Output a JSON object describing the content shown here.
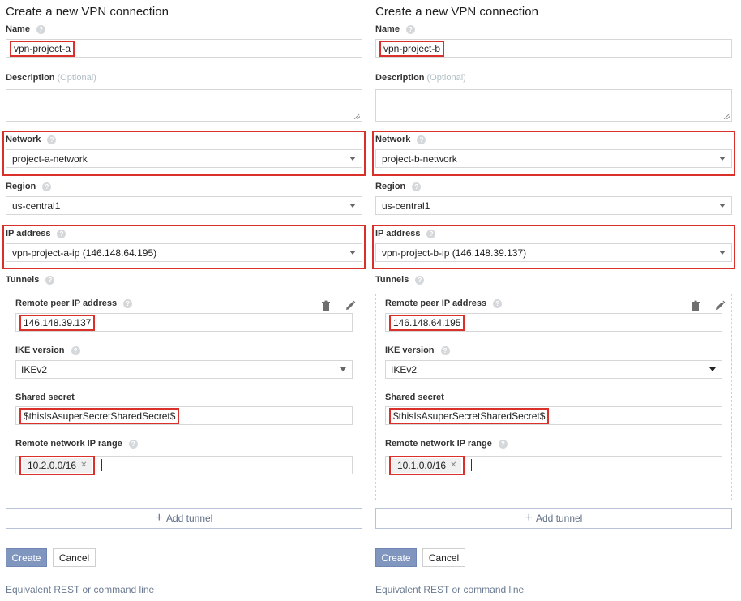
{
  "panels": [
    {
      "title": "Create a new VPN connection",
      "name_label": "Name",
      "name_value": "vpn-project-a",
      "description_label": "Description",
      "description_optional": "(Optional)",
      "network_label": "Network",
      "network_value": "project-a-network",
      "region_label": "Region",
      "region_value": "us-central1",
      "ip_label": "IP address",
      "ip_value": "vpn-project-a-ip (146.148.64.195)",
      "tunnels_label": "Tunnels",
      "peer_label": "Remote peer IP address",
      "peer_value": "146.148.39.137",
      "ike_label": "IKE version",
      "ike_value": "IKEv2",
      "secret_label": "Shared secret",
      "secret_value": "$thisIsAsuperSecretSharedSecret$",
      "range_label": "Remote network IP range",
      "range_value": "10.2.0.0/16",
      "add_tunnel": "Add tunnel",
      "create": "Create",
      "cancel": "Cancel",
      "rest_link": "Equivalent REST or command line"
    },
    {
      "title": "Create a new VPN connection",
      "name_label": "Name",
      "name_value": "vpn-project-b",
      "description_label": "Description",
      "description_optional": "(Optional)",
      "network_label": "Network",
      "network_value": "project-b-network",
      "region_label": "Region",
      "region_value": "us-central1",
      "ip_label": "IP address",
      "ip_value": "vpn-project-b-ip (146.148.39.137)",
      "tunnels_label": "Tunnels",
      "peer_label": "Remote peer IP address",
      "peer_value": "146.148.64.195",
      "ike_label": "IKE version",
      "ike_value": "IKEv2",
      "secret_label": "Shared secret",
      "secret_value": "$thisIsAsuperSecretSharedSecret$",
      "range_label": "Remote network IP range",
      "range_value": "10.1.0.0/16",
      "add_tunnel": "Add tunnel",
      "create": "Create",
      "cancel": "Cancel",
      "rest_link": "Equivalent REST or command line"
    }
  ],
  "icons": {
    "help": "?",
    "chip_remove": "✕",
    "plus": "+",
    "delete": "trash-icon",
    "edit": "pencil-icon"
  },
  "colors": {
    "highlight": "#d9302a",
    "primary_button": "#8196bf",
    "link": "#6b7b91"
  }
}
